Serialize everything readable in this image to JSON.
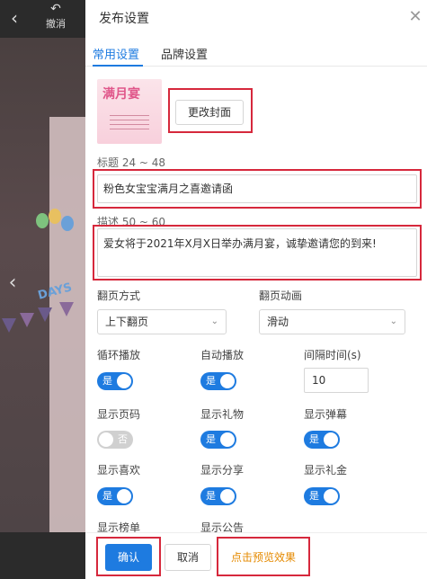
{
  "editor": {
    "back_icon": "chevron-left-icon",
    "undo_label": "撤消",
    "undo_icon": "undo-arrow-icon",
    "canvas_text": "DAYS",
    "prev_icon": "chevron-left-icon"
  },
  "panel": {
    "title": "发布设置",
    "close_icon": "close-icon",
    "tabs": [
      {
        "label": "常用设置",
        "active": true
      },
      {
        "label": "品牌设置",
        "active": false
      }
    ],
    "cover": {
      "thumb_title": "满月宴",
      "change_label": "更改封面"
    },
    "title_field": {
      "label": "标题 24 ~ 48",
      "value": "粉色女宝宝满月之喜邀请函"
    },
    "desc_field": {
      "label": "描述 50 ~ 60",
      "value": "爱女将于2021年X月X日举办满月宴，诚挚邀请您的到来!"
    },
    "page_turn": {
      "label": "翻页方式",
      "value": "上下翻页"
    },
    "page_anim": {
      "label": "翻页动画",
      "value": "滑动"
    },
    "options": {
      "loop": {
        "label": "循环播放",
        "state": "是",
        "on": true
      },
      "autoplay": {
        "label": "自动播放",
        "state": "是",
        "on": true
      },
      "interval": {
        "label": "间隔时间(s)",
        "value": "10"
      },
      "page_num": {
        "label": "显示页码",
        "state": "否",
        "on": false
      },
      "gift": {
        "label": "显示礼物",
        "state": "是",
        "on": true
      },
      "danmaku": {
        "label": "显示弹幕",
        "state": "是",
        "on": true
      },
      "likes": {
        "label": "显示喜欢",
        "state": "是",
        "on": true
      },
      "share": {
        "label": "显示分享",
        "state": "是",
        "on": true
      },
      "cash_gift": {
        "label": "显示礼金",
        "state": "是",
        "on": true
      },
      "ranking": {
        "label": "显示榜单"
      },
      "notice": {
        "label": "显示公告"
      }
    },
    "footer": {
      "confirm_label": "确认",
      "cancel_label": "取消",
      "preview_label": "点击预览效果"
    }
  },
  "colors": {
    "accent": "#1e7be0",
    "highlight_box": "#d6283c",
    "preview_link": "#e58a00",
    "switch_off": "#d0d0d0"
  }
}
